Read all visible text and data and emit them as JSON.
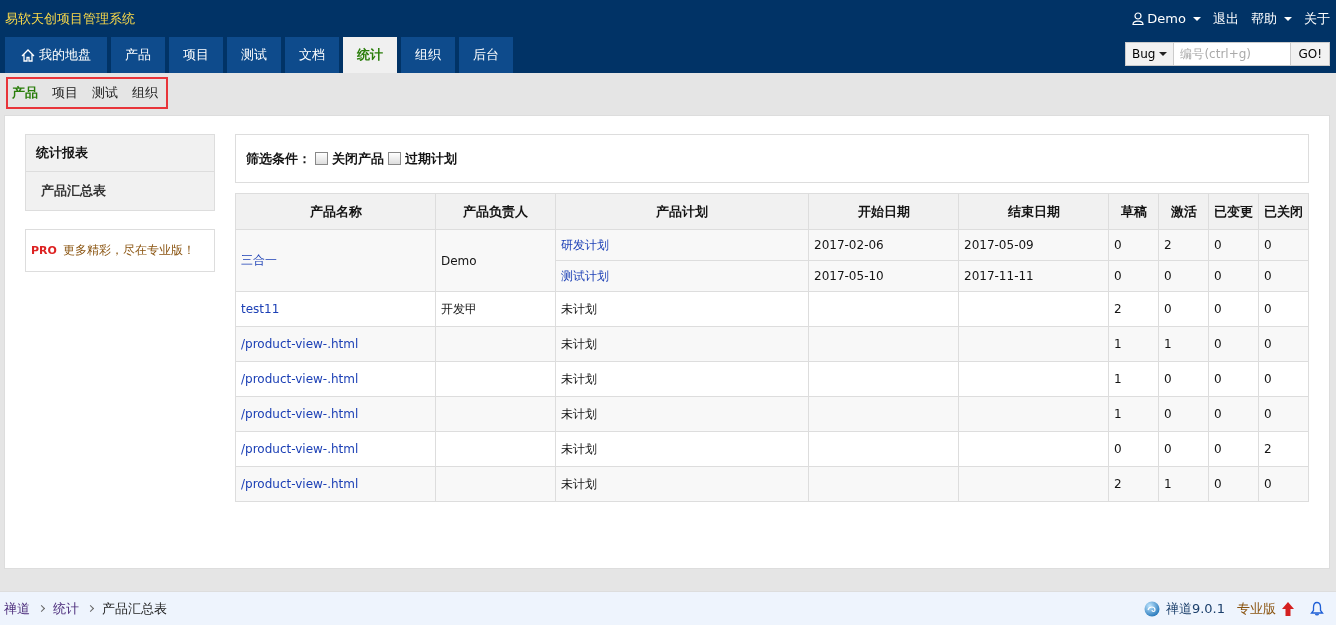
{
  "app_title": "易软天创项目管理系统",
  "user_menu": {
    "user": "Demo",
    "logout": "退出",
    "help": "帮助",
    "about": "关于"
  },
  "main_tabs": [
    {
      "label": "我的地盘",
      "kind": "home",
      "selected": false
    },
    {
      "label": "产品",
      "selected": false
    },
    {
      "label": "项目",
      "selected": false
    },
    {
      "label": "测试",
      "selected": false
    },
    {
      "label": "文档",
      "selected": false
    },
    {
      "label": "统计",
      "selected": true
    },
    {
      "label": "组织",
      "selected": false
    },
    {
      "label": "后台",
      "selected": false
    }
  ],
  "quick_search": {
    "type": "Bug",
    "placeholder": "编号(ctrl+g)",
    "button": "GO!"
  },
  "sub_tabs": [
    {
      "label": "产品",
      "selected": true
    },
    {
      "label": "项目",
      "selected": false
    },
    {
      "label": "测试",
      "selected": false
    },
    {
      "label": "组织",
      "selected": false
    }
  ],
  "sidebar": {
    "title": "统计报表",
    "items": [
      {
        "label": "产品汇总表"
      }
    ],
    "pro_badge": "PRO",
    "pro_text": "更多精彩，尽在专业版！"
  },
  "filter": {
    "label": "筛选条件：",
    "options": [
      {
        "label": "关闭产品",
        "checked": false
      },
      {
        "label": "过期计划",
        "checked": false
      }
    ]
  },
  "table": {
    "columns": [
      "产品名称",
      "产品负责人",
      "产品计划",
      "开始日期",
      "结束日期",
      "草稿",
      "激活",
      "已变更",
      "已关闭"
    ],
    "products": [
      {
        "name": "三合一",
        "owner": "Demo",
        "plans": [
          {
            "plan": "研发计划",
            "start": "2017-02-06",
            "end": "2017-05-09",
            "draft": "0",
            "active": "2",
            "changed": "0",
            "closed": "0"
          },
          {
            "plan": "测试计划",
            "start": "2017-05-10",
            "end": "2017-11-11",
            "draft": "0",
            "active": "0",
            "changed": "0",
            "closed": "0"
          }
        ]
      },
      {
        "name": "test11",
        "owner": "开发甲",
        "plans": [
          {
            "plan": "未计划",
            "draft": "2",
            "active": "0",
            "changed": "0",
            "closed": "0"
          }
        ]
      },
      {
        "name": "/product-view-.html",
        "plans": [
          {
            "plan": "未计划",
            "draft": "1",
            "active": "1",
            "changed": "0",
            "closed": "0"
          }
        ]
      },
      {
        "name": "/product-view-.html",
        "plans": [
          {
            "plan": "未计划",
            "draft": "1",
            "active": "0",
            "changed": "0",
            "closed": "0"
          }
        ]
      },
      {
        "name": "/product-view-.html",
        "plans": [
          {
            "plan": "未计划",
            "draft": "1",
            "active": "0",
            "changed": "0",
            "closed": "0"
          }
        ]
      },
      {
        "name": "/product-view-.html",
        "plans": [
          {
            "plan": "未计划",
            "draft": "0",
            "active": "0",
            "changed": "0",
            "closed": "2"
          }
        ]
      },
      {
        "name": "/product-view-.html",
        "plans": [
          {
            "plan": "未计划",
            "draft": "2",
            "active": "1",
            "changed": "0",
            "closed": "0"
          }
        ]
      }
    ]
  },
  "breadcrumb": [
    "禅道",
    "统计",
    "产品汇总表"
  ],
  "footer": {
    "version": "禅道9.0.1",
    "pro_link": "专业版"
  }
}
